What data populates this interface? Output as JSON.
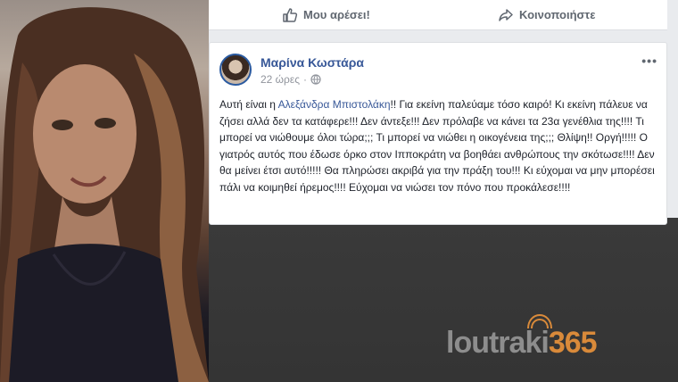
{
  "actions": {
    "like_label": "Μου αρέσει!",
    "share_label": "Κοινοποιήστε"
  },
  "post": {
    "author": "Μαρίνα Κωστάρα",
    "time": "22 ώρες",
    "text_before_mention": "Αυτή είναι η ",
    "mention": "Αλεξάνδρα Μπιστολάκη",
    "text_after_mention": "!! Για εκείνη παλεύαμε τόσο καιρό! Κι εκείνη πάλευε να ζήσει αλλά δεν τα κατάφερε!!! Δεν άντεξε!!! Δεν πρόλαβε να κάνει τα 23α γενέθλια της!!!! Τι μπορεί να νιώθουμε όλοι τώρα;;; Τι μπορεί να νιώθει η οικογένεια της;;; Θλίψη!! Οργή!!!!! Ο γιατρός αυτός που έδωσε όρκο στον Ιπποκράτη να βοηθάει ανθρώπους την σκότωσε!!!! Δεν θα μείνει έτσι αυτό!!!!! Θα πληρώσει ακριβά για την πράξη του!!! Κι εύχομαι να μην μπορέσει πάλι να κοιμηθεί ήρεμος!!!! Εύχομαι να νιώσει τον πόνο που προκάλεσε!!!!",
    "menu_label": "•••"
  },
  "watermark": {
    "part1": "loutraki",
    "part2": "365"
  },
  "icons": {
    "like": "thumbs-up-icon",
    "share": "share-arrow-icon",
    "privacy": "globe-icon"
  },
  "colors": {
    "link": "#385898",
    "muted": "#90949c",
    "watermark_accent": "#d98a3a"
  }
}
